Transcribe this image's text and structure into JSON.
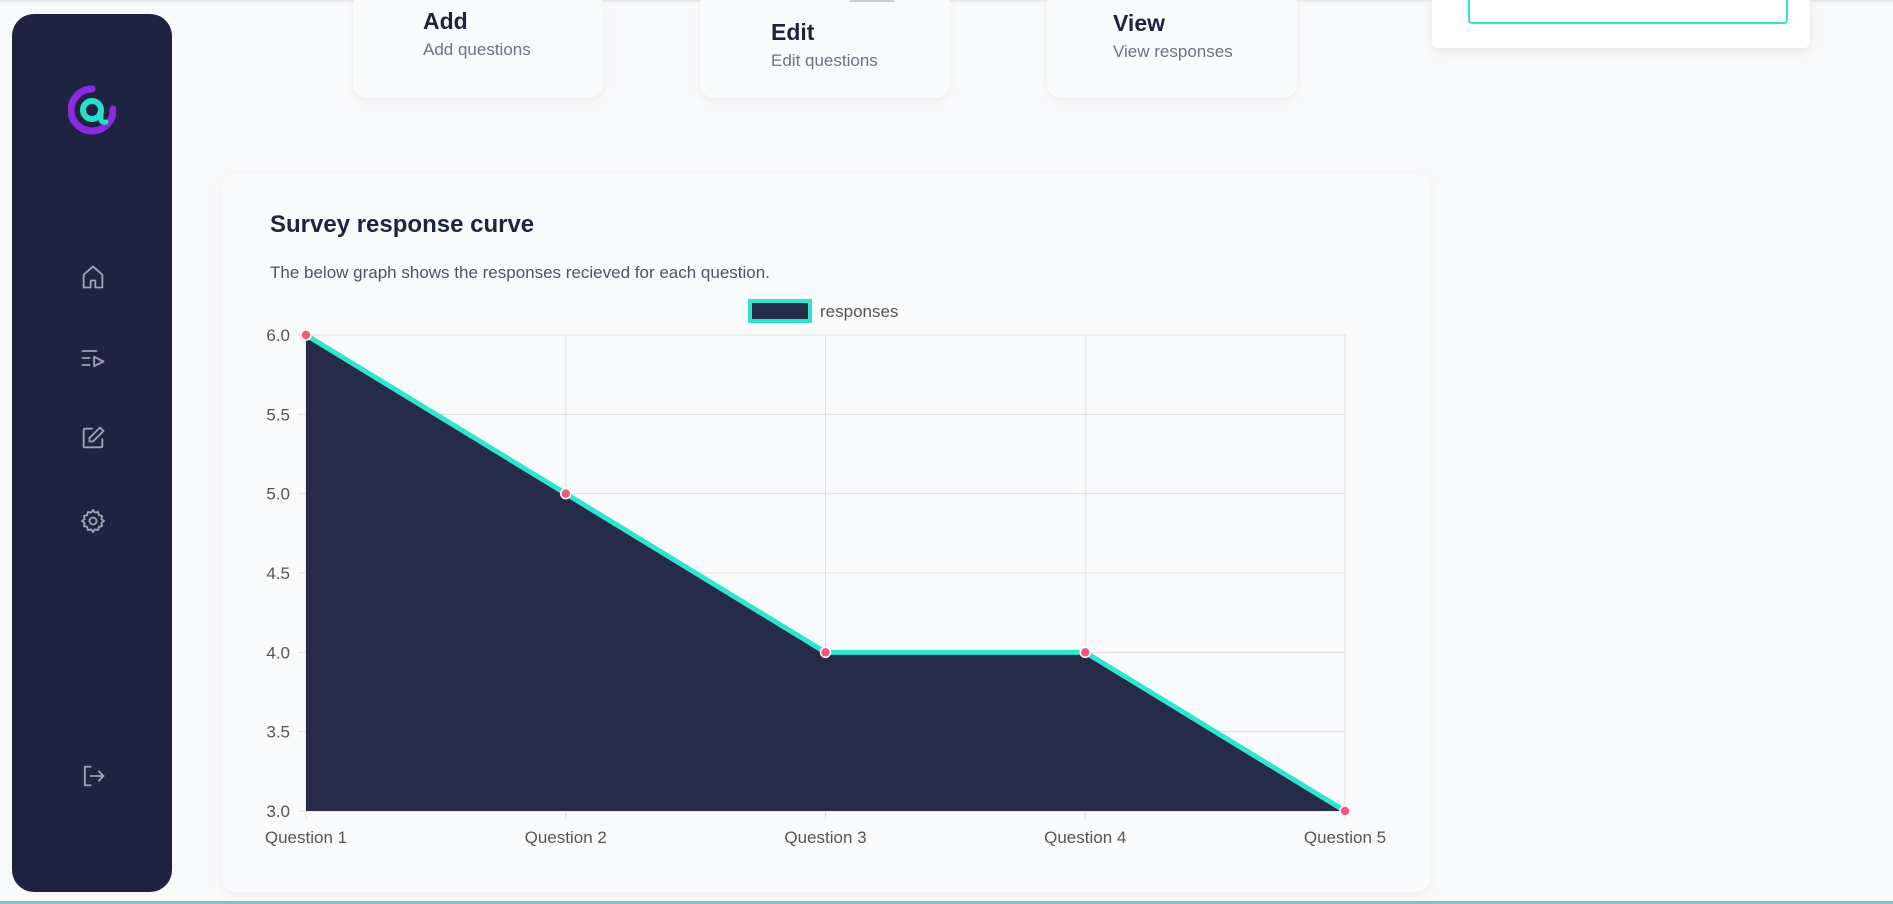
{
  "sidebar": {
    "nav": [
      {
        "icon": "home-icon"
      },
      {
        "icon": "playlist-icon"
      },
      {
        "icon": "edit-icon"
      },
      {
        "icon": "settings-icon"
      },
      {
        "icon": "logout-icon"
      }
    ],
    "logo_icon": "at-logo-icon"
  },
  "cards": [
    {
      "title": "Add",
      "subtitle": "Add questions"
    },
    {
      "title": "Edit",
      "subtitle": "Edit questions"
    },
    {
      "title": "View",
      "subtitle": "View responses"
    }
  ],
  "chart_section": {
    "title": "Survey response curve",
    "description": "The below graph shows the responses recieved for each question."
  },
  "colors": {
    "sidebar": "#1f2342",
    "fill": "#262b47",
    "line": "#2ee6cf",
    "points": "#f3577a",
    "logo_purple": "#8a2be2",
    "logo_teal": "#27e0c8"
  },
  "chart_data": {
    "type": "area",
    "categories": [
      "Question 1",
      "Question 2",
      "Question 3",
      "Question 4",
      "Question 5"
    ],
    "series": [
      {
        "name": "responses",
        "values": [
          6,
          5,
          4,
          4,
          3
        ]
      }
    ],
    "ylim": [
      3.0,
      6.0
    ],
    "yticks": [
      "6.0",
      "5.5",
      "5.0",
      "4.5",
      "4.0",
      "3.5",
      "3.0"
    ],
    "grid": true,
    "legend": "top-center"
  }
}
